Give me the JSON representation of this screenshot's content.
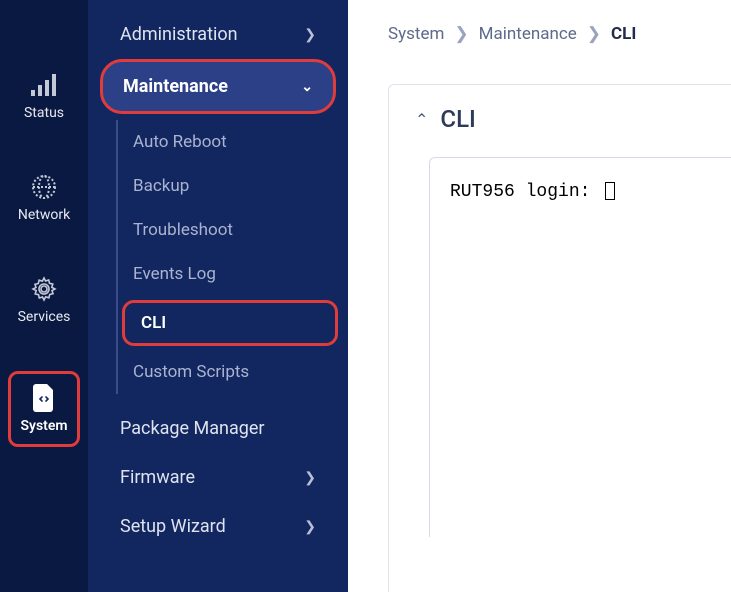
{
  "rail": {
    "items": [
      {
        "label": "Status",
        "icon": "signal"
      },
      {
        "label": "Network",
        "icon": "globe"
      },
      {
        "label": "Services",
        "icon": "gear"
      },
      {
        "label": "System",
        "icon": "file-code"
      }
    ]
  },
  "subnav": {
    "items": [
      {
        "label": "Administration",
        "expandable": true
      },
      {
        "label": "Maintenance",
        "expandable": true,
        "expanded": true
      },
      {
        "label": "Package Manager",
        "expandable": false
      },
      {
        "label": "Firmware",
        "expandable": true
      },
      {
        "label": "Setup Wizard",
        "expandable": true
      }
    ],
    "maintenance_children": [
      {
        "label": "Auto Reboot"
      },
      {
        "label": "Backup"
      },
      {
        "label": "Troubleshoot"
      },
      {
        "label": "Events Log"
      },
      {
        "label": "CLI"
      },
      {
        "label": "Custom Scripts"
      }
    ]
  },
  "breadcrumb": {
    "parts": [
      "System",
      "Maintenance",
      "CLI"
    ]
  },
  "panel": {
    "title": "CLI"
  },
  "terminal": {
    "prompt": "RUT956 login: "
  }
}
